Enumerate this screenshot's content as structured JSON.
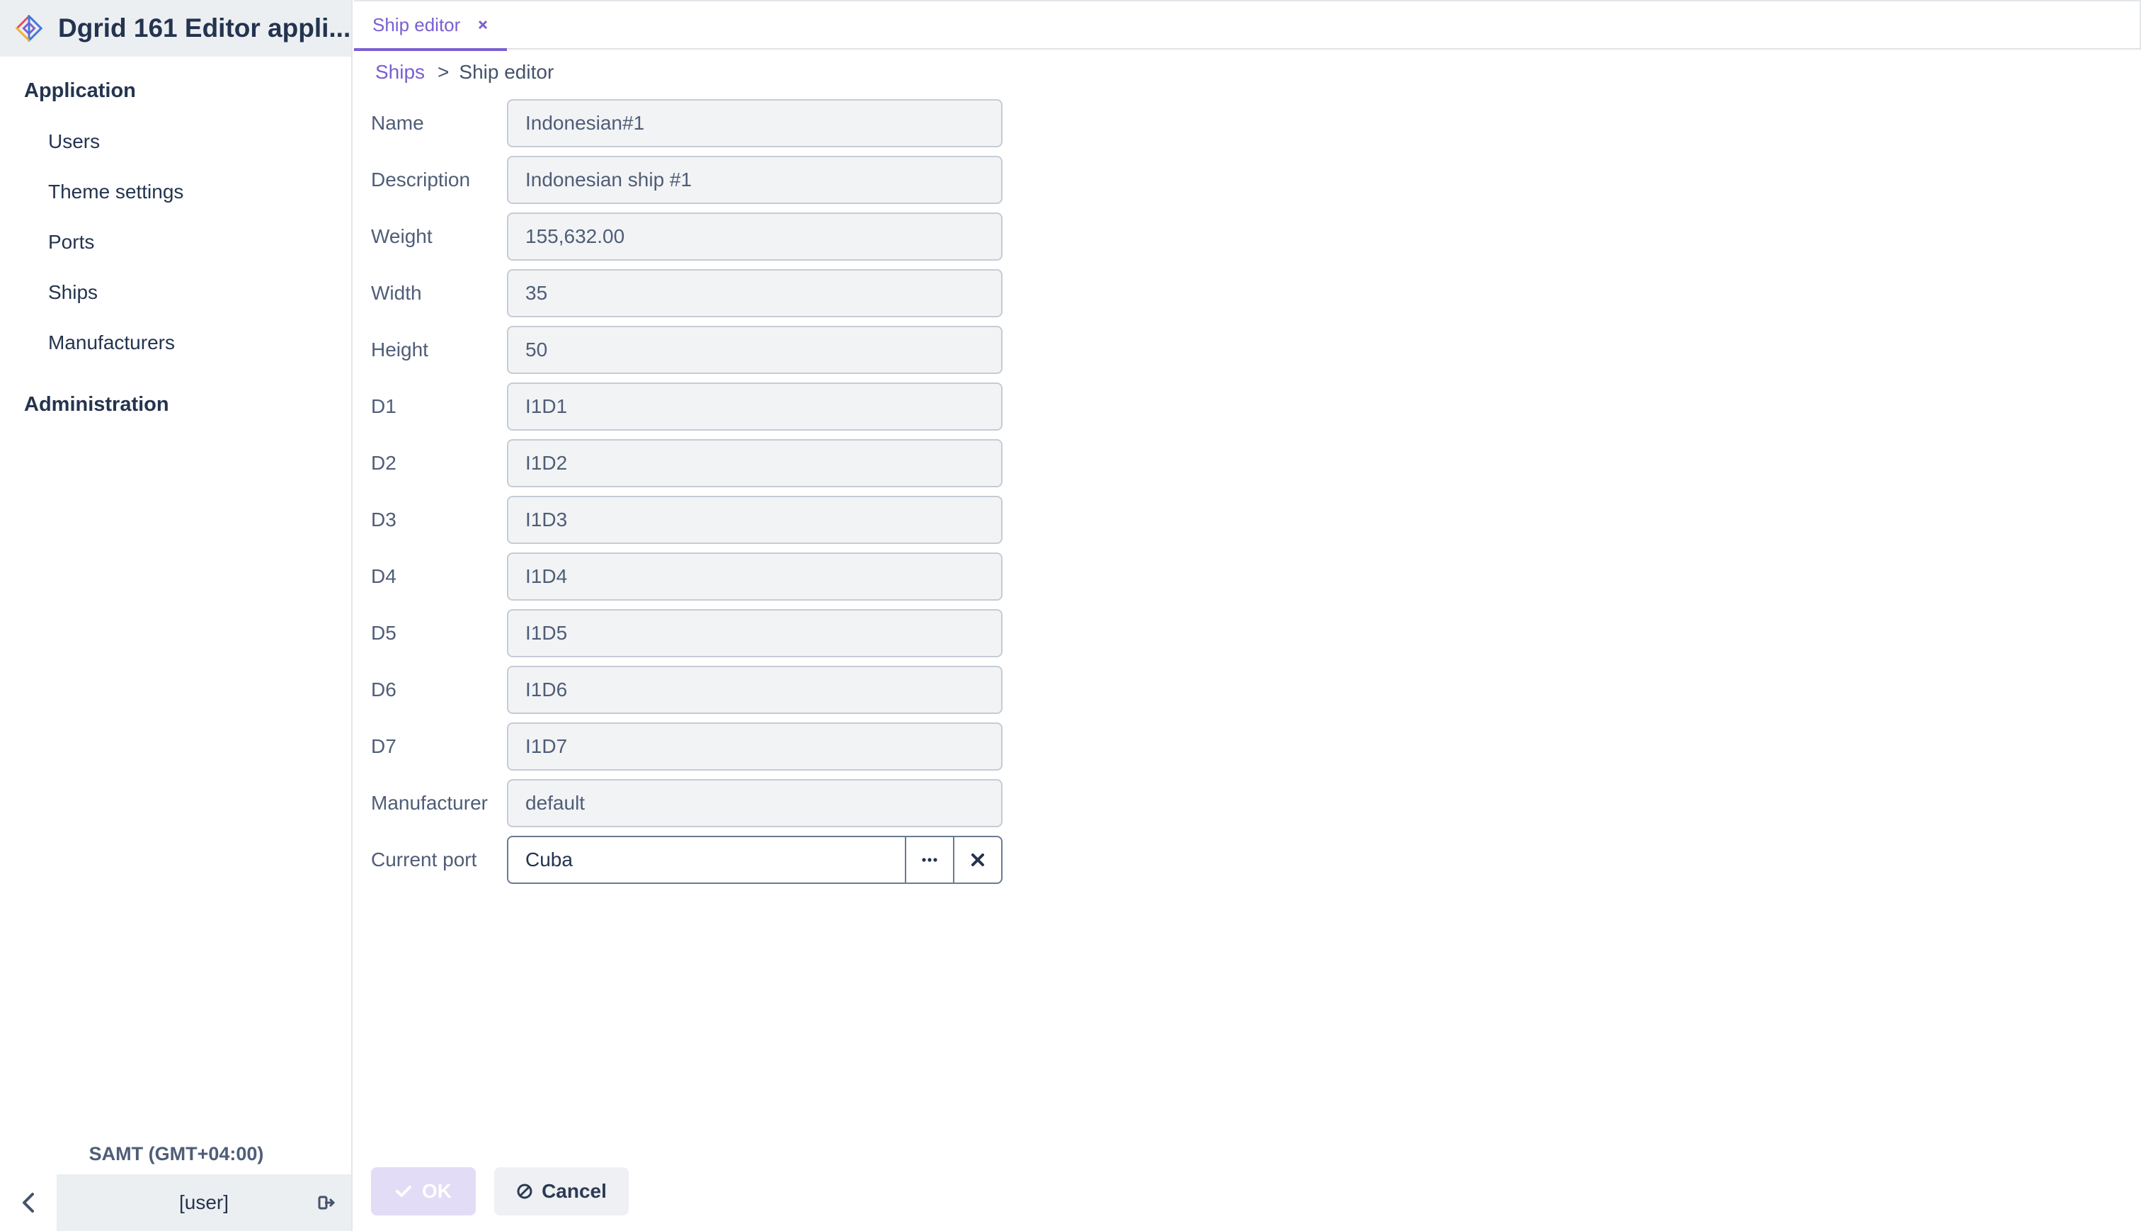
{
  "app": {
    "title": "Dgrid 161 Editor appli..."
  },
  "sidebar": {
    "groups": [
      {
        "label": "Application"
      },
      {
        "label": "Administration"
      }
    ],
    "items": [
      {
        "label": "Users"
      },
      {
        "label": "Theme settings"
      },
      {
        "label": "Ports"
      },
      {
        "label": "Ships"
      },
      {
        "label": "Manufacturers"
      }
    ],
    "timezone": "SAMT (GMT+04:00)",
    "user": "[user]"
  },
  "tabs": [
    {
      "label": "Ship editor",
      "close": "×"
    }
  ],
  "breadcrumb": {
    "parent": "Ships",
    "separator": ">",
    "current": "Ship editor"
  },
  "form": {
    "fields": [
      {
        "label": "Name",
        "value": "Indonesian#1"
      },
      {
        "label": "Description",
        "value": "Indonesian ship #1"
      },
      {
        "label": "Weight",
        "value": "155,632.00"
      },
      {
        "label": "Width",
        "value": "35"
      },
      {
        "label": "Height",
        "value": "50"
      },
      {
        "label": "D1",
        "value": "I1D1"
      },
      {
        "label": "D2",
        "value": "I1D2"
      },
      {
        "label": "D3",
        "value": "I1D3"
      },
      {
        "label": "D4",
        "value": "I1D4"
      },
      {
        "label": "D5",
        "value": "I1D5"
      },
      {
        "label": "D6",
        "value": "I1D6"
      },
      {
        "label": "D7",
        "value": "I1D7"
      },
      {
        "label": "Manufacturer",
        "value": "default"
      }
    ],
    "current_port": {
      "label": "Current port",
      "value": "Cuba"
    }
  },
  "actions": {
    "ok": "OK",
    "cancel": "Cancel"
  },
  "colors": {
    "accent": "#7a5fd1",
    "text": "#24344f",
    "field_bg": "#f2f3f5"
  }
}
